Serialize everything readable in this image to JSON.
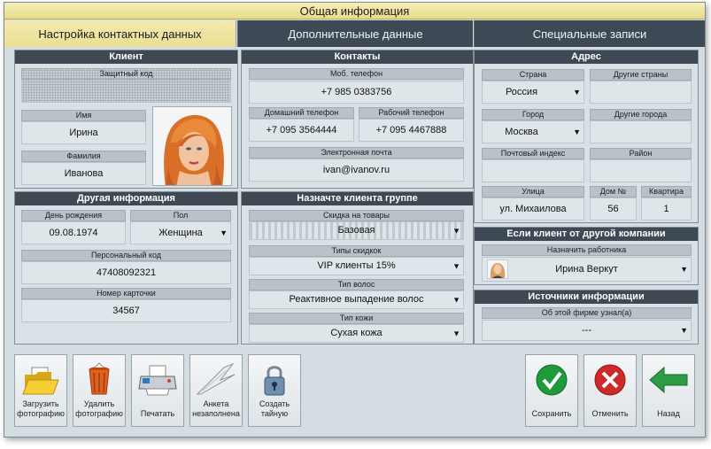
{
  "title": "Общая информация",
  "tabs": [
    "Настройка контактных данных",
    "Дополнительные данные",
    "Специальные записи"
  ],
  "client": {
    "header": "Клиент",
    "security_code_label": "Защитный код",
    "security_code": "",
    "first_name_label": "Имя",
    "first_name": "Ирина",
    "last_name_label": "Фамилия",
    "last_name": "Иванова"
  },
  "contacts": {
    "header": "Контакты",
    "mobile_label": "Моб. телефон",
    "mobile": "+7 985 0383756",
    "home_label": "Домашний телефон",
    "home": "+7 095 3564444",
    "work_label": "Рабочий телефон",
    "work": "+7 095 4467888",
    "email_label": "Электронная почта",
    "email": "ivan@ivanov.ru"
  },
  "address": {
    "header": "Адрес",
    "country_label": "Страна",
    "country": "Россия",
    "other_countries_label": "Другие страны",
    "city_label": "Город",
    "city": "Москва",
    "other_cities_label": "Другие города",
    "zip_label": "Почтовый индекс",
    "district_label": "Район",
    "street_label": "Улица",
    "street": "ул. Михаилова",
    "house_label": "Дом №",
    "house": "56",
    "apt_label": "Квартира",
    "apt": "1"
  },
  "other": {
    "header": "Другая информация",
    "birthday_label": "День рождения",
    "birthday": "09.08.1974",
    "gender_label": "Пол",
    "gender": "Женщина",
    "personal_code_label": "Персональный код",
    "personal_code": "47408092321",
    "card_label": "Номер карточки",
    "card": "34567"
  },
  "group": {
    "header": "Назначте клиента группе",
    "discount_label": "Скидка на товары",
    "discount": "Базовая",
    "discount_types_label": "Типы скидкок",
    "discount_type": "VIP клиенты 15%",
    "hair_label": "Тип волос",
    "hair": "Реактивное выпадение волос",
    "skin_label": "Тип кожи",
    "skin": "Сухая кожа"
  },
  "company": {
    "header": "Если клиент от другой компании",
    "assign_label": "Назначить работника",
    "employee": "Ирина Веркут"
  },
  "sources": {
    "header": "Источники информации",
    "heard_label": "Об этой фирме узнал(а)",
    "heard": "---"
  },
  "buttons": {
    "upload_photo": [
      "Загрузить",
      "фотографию"
    ],
    "delete_photo": [
      "Удалить",
      "фотографию"
    ],
    "print": "Печатать",
    "questionnaire": [
      "Анкета",
      "незаполнена"
    ],
    "create_secret": [
      "Создать",
      "тайную"
    ],
    "save": "Сохранить",
    "cancel": "Отменить",
    "back": "Назад"
  },
  "colors": {
    "header_dark": "#3e4954",
    "tab_active": "#ede39f",
    "panel": "#d9e1e6",
    "save_green": "#1f9a3a",
    "cancel_red": "#cf2a2a",
    "back_green": "#2e9b45"
  }
}
